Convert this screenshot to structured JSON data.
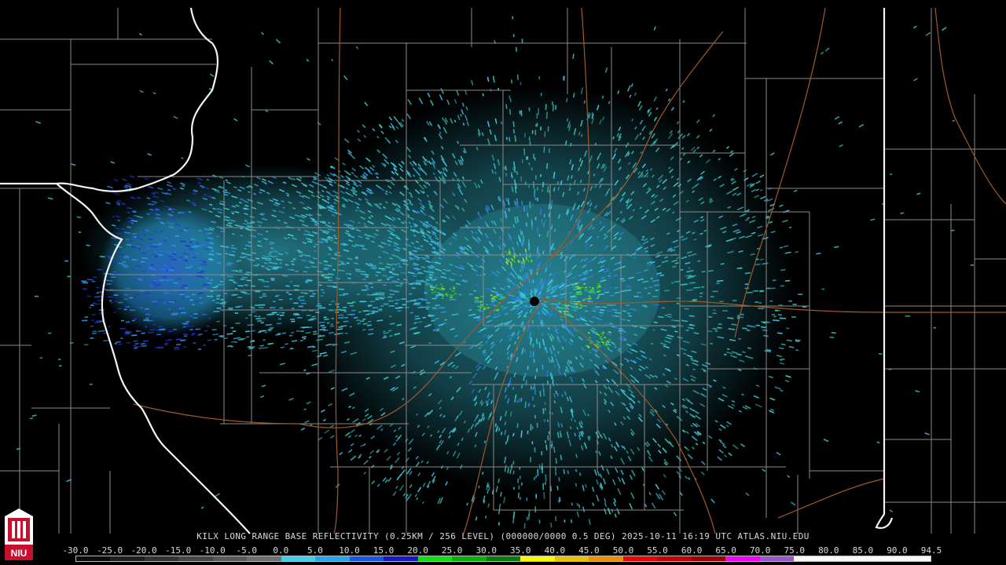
{
  "product": {
    "title": "KILX LONG RANGE BASE REFLECTIVITY (0.25KM / 256 LEVEL) (000000/0000 0.5 DEG) 2025-10-11 16:19 UTC  ATLAS.NIU.EDU"
  },
  "radar": {
    "site": "KILX",
    "echo_colors": [
      "#33b3b0",
      "#3fd0c8",
      "#45c7ea",
      "#2fa1e8",
      "#2e7ae8",
      "#1b3fd0",
      "#2a2ad8",
      "#34c12c",
      "#9cde2a"
    ]
  },
  "logo": {
    "text": "NIU",
    "color": "#c8102e"
  },
  "colorbar": {
    "labels": [
      "-30.0",
      "-25.0",
      "-20.0",
      "-15.0",
      "-10.0",
      "-5.0",
      "0.0",
      "5.0",
      "10.0",
      "15.0",
      "20.0",
      "25.0",
      "30.0",
      "35.0",
      "40.0",
      "45.0",
      "50.0",
      "55.0",
      "60.0",
      "65.0",
      "70.0",
      "75.0",
      "80.0",
      "85.0",
      "90.0",
      "94.5"
    ],
    "stops": [
      "#0a0a0a",
      "#1e1e1e",
      "#323232",
      "#464646",
      "#5a5a5a",
      "#6e6e6e",
      "#3fd0e8",
      "#26a4f0",
      "#1a54e8",
      "#1717c8",
      "#0ee010",
      "#08b008",
      "#087a08",
      "#f8f800",
      "#e8c000",
      "#f08c00",
      "#f00000",
      "#c80000",
      "#a00000",
      "#f800f8",
      "#9858c8",
      "#f8f8f8",
      "#f8f8f8",
      "#f8f8f8",
      "#f8f8f8"
    ]
  }
}
